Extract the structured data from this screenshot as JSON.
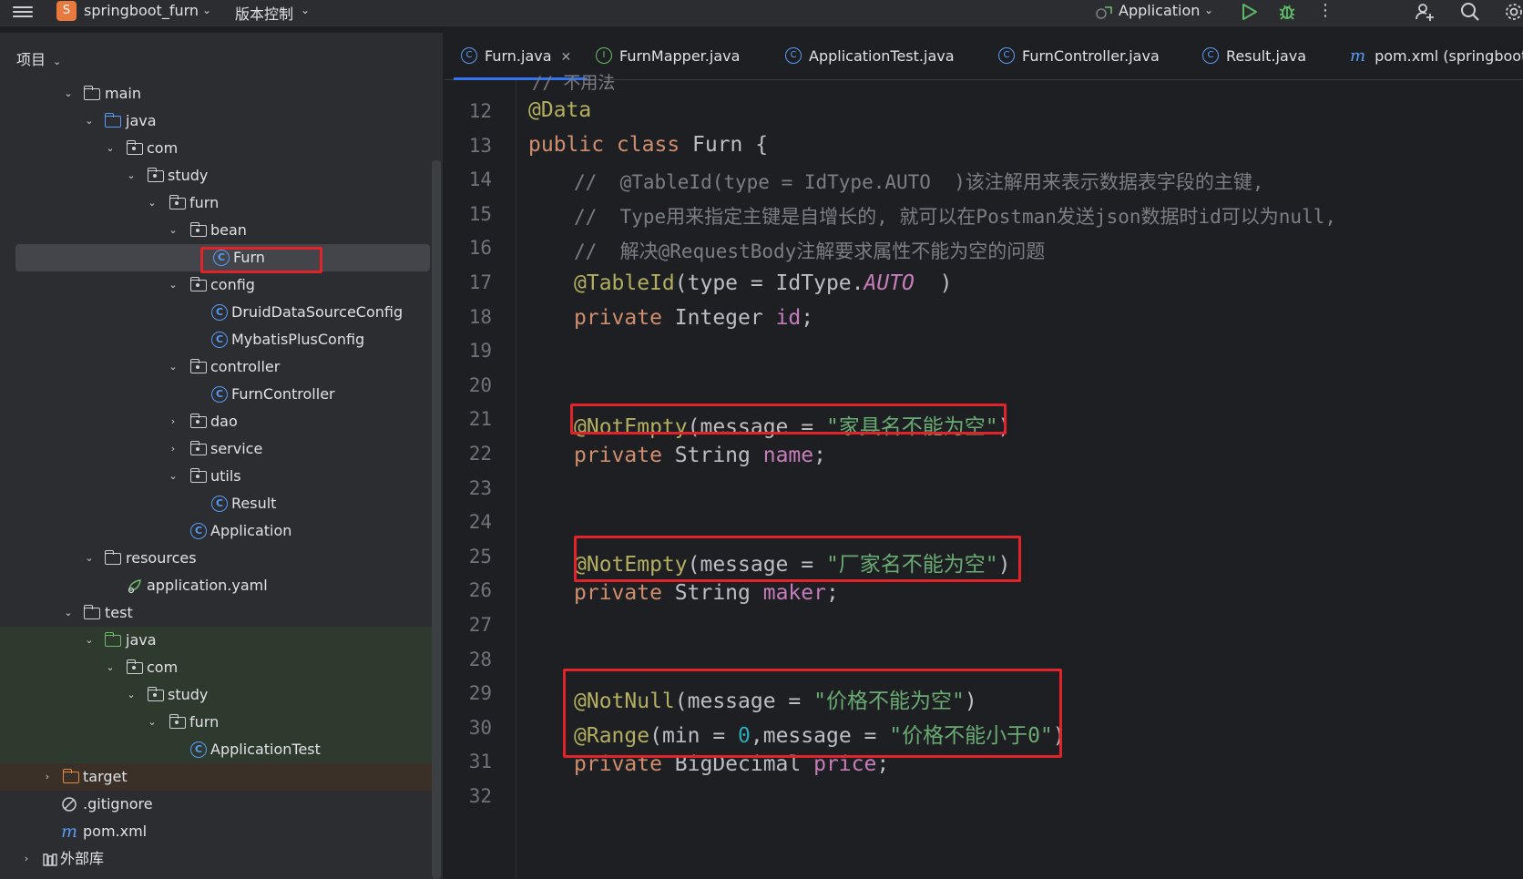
{
  "topbar": {
    "project_badge": "S",
    "project_name": "springboot_furn",
    "vcs_label": "版本控制",
    "run_config": "Application",
    "more": "⋮"
  },
  "project_panel": {
    "header": "项目",
    "tree": [
      {
        "label": "main"
      },
      {
        "label": "java"
      },
      {
        "label": "com"
      },
      {
        "label": "study"
      },
      {
        "label": "furn"
      },
      {
        "label": "bean"
      },
      {
        "label": "Furn"
      },
      {
        "label": "config"
      },
      {
        "label": "DruidDataSourceConfig"
      },
      {
        "label": "MybatisPlusConfig"
      },
      {
        "label": "controller"
      },
      {
        "label": "FurnController"
      },
      {
        "label": "dao"
      },
      {
        "label": "service"
      },
      {
        "label": "utils"
      },
      {
        "label": "Result"
      },
      {
        "label": "Application"
      },
      {
        "label": "resources"
      },
      {
        "label": "application.yaml"
      },
      {
        "label": "test"
      },
      {
        "label": "java"
      },
      {
        "label": "com"
      },
      {
        "label": "study"
      },
      {
        "label": "furn"
      },
      {
        "label": "ApplicationTest"
      },
      {
        "label": "target"
      },
      {
        "label": ".gitignore"
      },
      {
        "label": "pom.xml"
      },
      {
        "label": "外部库"
      }
    ]
  },
  "tabs": [
    {
      "label": "Furn.java",
      "icon": "C"
    },
    {
      "label": "FurnMapper.java",
      "icon": "I"
    },
    {
      "label": "ApplicationTest.java",
      "icon": "C"
    },
    {
      "label": "FurnController.java",
      "icon": "C"
    },
    {
      "label": "Result.java",
      "icon": "C"
    },
    {
      "label": "pom.xml (springboot_",
      "icon": "m"
    }
  ],
  "editor": {
    "partial_top_line": "// 不用法",
    "line_numbers": [
      "12",
      "13",
      "14",
      "15",
      "16",
      "17",
      "18",
      "19",
      "20",
      "21",
      "22",
      "23",
      "24",
      "25",
      "26",
      "27",
      "28",
      "29",
      "30",
      "31",
      "32"
    ],
    "code": {
      "l12_ann": "@Data",
      "l13_kw": "public class ",
      "l13_rest": "Furn {",
      "l14_cmt": "//  @TableId(type = IdType.AUTO  )该注解用来表示数据表字段的主键,",
      "l15_cmt": "//  Type用来指定主键是自增长的, 就可以在Postman发送json数据时id可以为null,",
      "l16_cmt": "//  解决@RequestBody注解要求属性不能为空的问题",
      "l17_ann": "@TableId",
      "l17_a": "(type = IdType.",
      "l17_const": "AUTO",
      "l17_b": "  )",
      "l18_kw": "private ",
      "l18_type": "Integer ",
      "l18_fld": "id",
      "l18_end": ";",
      "l21_ann": "@NotEmpty",
      "l21_a": "(message = ",
      "l21_str": "\"家具名不能为空\"",
      "l21_b": ")",
      "l22_kw": "private ",
      "l22_type": "String ",
      "l22_fld": "name",
      "l22_end": ";",
      "l25_ann": "@NotEmpty",
      "l25_a": "(message = ",
      "l25_str": "\"厂家名不能为空\"",
      "l25_b": ")",
      "l26_kw": "private ",
      "l26_type": "String ",
      "l26_fld": "maker",
      "l26_end": ";",
      "l29_ann": "@NotNull",
      "l29_a": "(message = ",
      "l29_str": "\"价格不能为空\"",
      "l29_b": ")",
      "l30_ann": "@Range",
      "l30_a": "(min = ",
      "l30_num": "0",
      "l30_b": ",message = ",
      "l30_str": "\"价格不能小于0\"",
      "l30_c": ")",
      "l31_kw": "private ",
      "l31_type": "BigDecimal ",
      "l31_fld": "price",
      "l31_end": ";"
    }
  },
  "icons": {
    "menu": "hamburger-menu-icon",
    "run": "run-icon",
    "debug": "debug-icon",
    "user": "add-user-icon",
    "search": "search-icon",
    "settings": "gear-icon"
  },
  "colors": {
    "accent": "#3574f0",
    "highlight_box": "#e0242a"
  }
}
